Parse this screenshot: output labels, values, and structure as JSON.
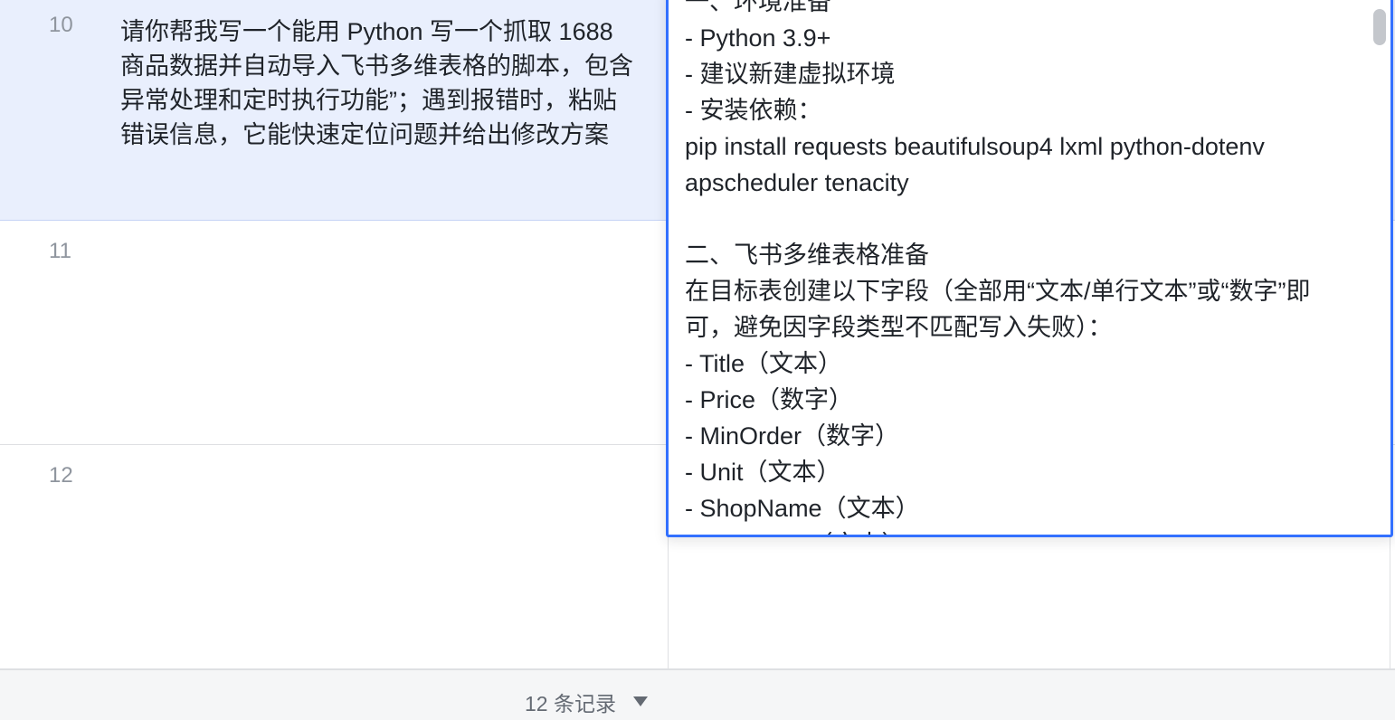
{
  "rows": [
    {
      "num": "10",
      "text_lines": [
        "请你帮我写一个能用 Python 写一个抓取 1688",
        "商品数据并自动导入飞书多维表格的脚本，包含",
        "异常处理和定时执行功能”；遇到报错时，粘贴",
        "错误信息，它能快速定位问题并给出修改方案"
      ]
    },
    {
      "num": "11"
    },
    {
      "num": "12"
    }
  ],
  "editor": {
    "lines": [
      "一、环境准备",
      "- Python 3.9+",
      "- 建议新建虚拟环境",
      "- 安装依赖：",
      "  pip install requests beautifulsoup4 lxml python-dotenv",
      "apscheduler tenacity",
      "",
      "二、飞书多维表格准备",
      "在目标表创建以下字段（全部用“文本/单行文本”或“数字”即",
      "可，避免因字段类型不匹配写入失败）：",
      "- Title（文本）",
      "- Price（数字）",
      "- MinOrder（数字）",
      "- Unit（文本）",
      "- ShopName（文本）",
      "- ProductID（文本）"
    ]
  },
  "footer": {
    "record_count": "12 条记录",
    "dropdown_icon": "caret-down-icon"
  },
  "colors": {
    "selection_bg": "#e9effd",
    "accent": "#3370ff"
  }
}
